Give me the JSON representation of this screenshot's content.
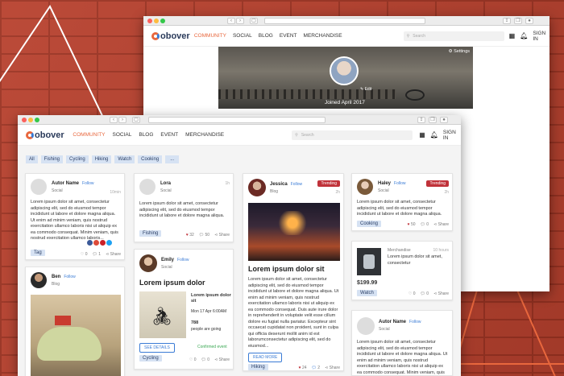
{
  "back_window": {
    "nav": {
      "logo": "obover",
      "items": [
        "COMMUNITY",
        "SOCIAL",
        "BLOG",
        "EVENT",
        "MERCHANDISE"
      ],
      "search_placeholder": "Search",
      "signin": "SIGN IN"
    },
    "profile": {
      "settings": "Settings",
      "edit": "Edit",
      "joined": "Joined April 2017"
    }
  },
  "front_window": {
    "nav": {
      "logo": "obover",
      "items": [
        "COMMUNITY",
        "SOCIAL",
        "BLOG",
        "EVENT",
        "MERCHANDISE"
      ],
      "search_placeholder": "Search",
      "signin": "SIGN IN"
    },
    "filters": [
      "All",
      "Fishing",
      "Cycling",
      "Hiking",
      "Watch",
      "Cooking",
      "..."
    ],
    "cards": {
      "c1": {
        "name": "Autor Name",
        "follow": "Follow",
        "sub": "Social",
        "time": "10min",
        "text": "Lorem ipsum dolor sit amet, consectetur adipiscing elit, sed do eiusmod tempor incididunt ut labore et dolore magna aliqua. Ut enim ad minim veniam, quis nostrud exercitation ullamco laboris nisi ut aliquip ex ea commodo consequat. Minim veniam, quis nostrud exercitation ullamco laboris...",
        "tag": "Tag",
        "likes": "0",
        "comments": "1",
        "share": "Share"
      },
      "c2": {
        "name": "Ben",
        "follow": "Follow",
        "sub": "Blog"
      },
      "c3": {
        "name": "Lora",
        "sub": "Social",
        "time": "1h",
        "text": "Lorem ipsum dolor sit amet, consectetur adipiscing elit, sed do eiusmod tempor incididunt ut labore et dolore magna aliqua.",
        "tag": "Fishing",
        "likes": "32",
        "comments": "50",
        "share": "Share"
      },
      "c4": {
        "name": "Emily",
        "follow": "Follow",
        "sub": "Social",
        "title": "Lorem ipsum dolor",
        "event_title": "Lorem ipsum dolor sit",
        "event_date": "Mon 17 Apr 6:00AM",
        "count": "788",
        "count_label": "people are going",
        "details": "SEE DETAILS",
        "status": "Confirmed event",
        "tag": "Cycling",
        "likes": "0",
        "comments": "0",
        "share": "Share"
      },
      "c5": {
        "name": "Jessica",
        "follow": "Follow",
        "sub": "Blog",
        "time": "2h",
        "badge": "Trending",
        "title": "Lorem ipsum dolor sit",
        "text": "Lorem ipsum dolor sit amet, consectetur adipiscing elit, sed do eiusmod tempor incididunt ut labore et dolore magna aliqua. Ut enim ad minim veniam, quis nostrud exercitation ullamco laboris nisi ut aliquip ex ea commodo consequat. Duis aute irure dolor in reprehenderit in voluptate velit esse cillum dolore eu fugiat nulla pariatur. Excepteur sint occaecat cupidatat non proident, sunt in culpa qui officia deserunt mollit anim id est laborumconsectetur adipiscing elit, sed do eiusmod...",
        "read_more": "READ MORE",
        "tag": "Hiking",
        "likes": "24",
        "comments": "2",
        "share": "Share"
      },
      "c6": {
        "name": "Haley",
        "follow": "Follow",
        "sub": "Social",
        "time": "2h",
        "badge": "Trending",
        "text": "Lorem ipsum dolor sit amet, consectetur adipiscing elit, sed do eiusmod tempor incididunt ut labore et dolore magna aliqua.",
        "tag": "Cooking",
        "likes": "50",
        "comments": "0",
        "share": "Share"
      },
      "c7": {
        "sub": "Merchandise",
        "time": "10 hours",
        "text": "Lorem ipsum dolor sit amet, consectetur",
        "price": "$199.99",
        "tag": "Watch",
        "likes": "0",
        "comments": "0",
        "share": "Share"
      },
      "c8": {
        "name": "Autor Name",
        "follow": "Follow",
        "sub": "Social",
        "text": "Lorem ipsum dolor sit amet, consectetur adipiscing elit, sed do eiusmod tempor incididunt ut labore et dolore magna aliqua. Ut enim ad minim veniam, quis nostrud exercitation ullamco laboris nisi ut aliquip ex ea commodo consequat. Minim veniam, quis nostrud exercitation"
      }
    }
  }
}
